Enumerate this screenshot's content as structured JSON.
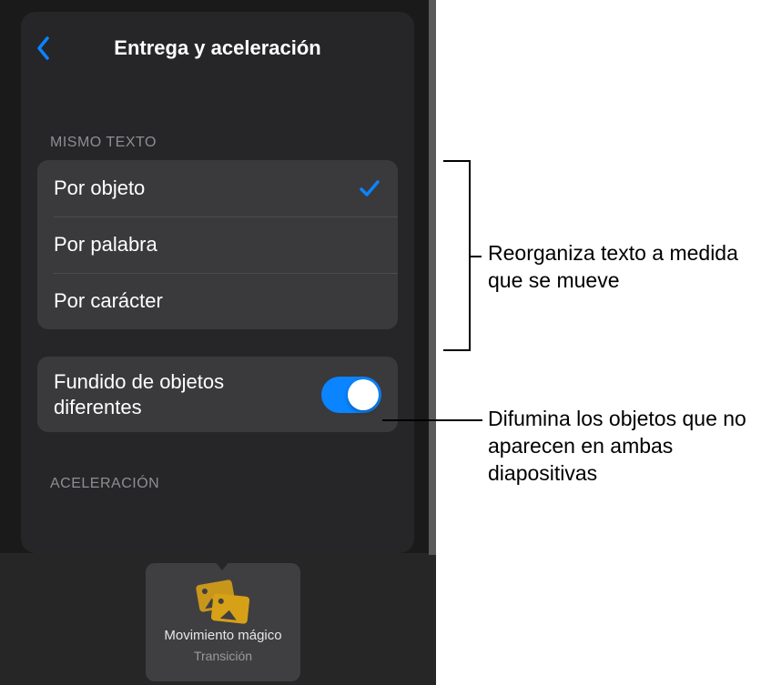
{
  "popover": {
    "title": "Entrega y aceleración",
    "section_same_text": "MISMO TEXTO",
    "options": [
      {
        "label": "Por objeto",
        "selected": true
      },
      {
        "label": "Por palabra",
        "selected": false
      },
      {
        "label": "Por carácter",
        "selected": false
      }
    ],
    "fade_toggle": {
      "label": "Fundido de objetos diferentes",
      "on": true
    },
    "section_acceleration": "ACELERACIÓN"
  },
  "slide_thumb": {
    "title": "Movimiento mágico",
    "subtitle": "Transición"
  },
  "callouts": {
    "reorg": "Reorganiza texto a medida que se mueve",
    "fade": "Difumina los objetos que no aparecen en ambas diapositivas"
  }
}
